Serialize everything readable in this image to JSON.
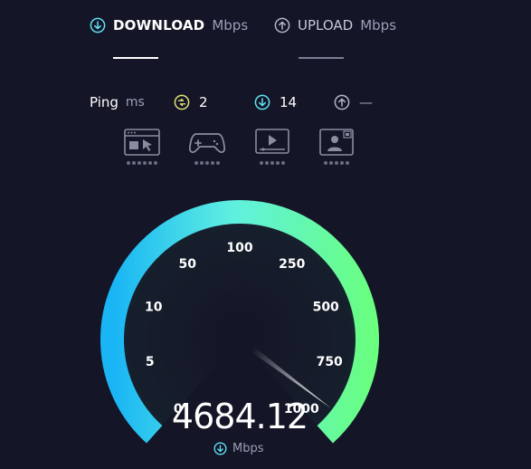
{
  "tabs": {
    "download": {
      "label": "DOWNLOAD",
      "unit": "Mbps",
      "active": true
    },
    "upload": {
      "label": "UPLOAD",
      "unit": "Mbps",
      "active": false
    }
  },
  "ping": {
    "label": "Ping",
    "unit": "ms",
    "idle_value": "2",
    "download_value": "14",
    "upload_value": "—"
  },
  "connection_icons": [
    {
      "icon": "browsing-icon",
      "dots": 6
    },
    {
      "icon": "gaming-icon",
      "dots": 5
    },
    {
      "icon": "video-streaming-icon",
      "dots": 5
    },
    {
      "icon": "video-call-icon",
      "dots": 5
    }
  ],
  "gauge": {
    "tick_labels": [
      "0",
      "5",
      "10",
      "50",
      "100",
      "250",
      "500",
      "750",
      "1000"
    ],
    "current_value": "4684.12",
    "unit": "Mbps",
    "needle_fraction": 0.96
  },
  "colors": {
    "accent_cyan": "#5fe4f5",
    "accent_green": "#6aff7a",
    "upload_icon": "#b3b6c8",
    "ping_idle": "#e3e37a",
    "background": "#141526"
  }
}
